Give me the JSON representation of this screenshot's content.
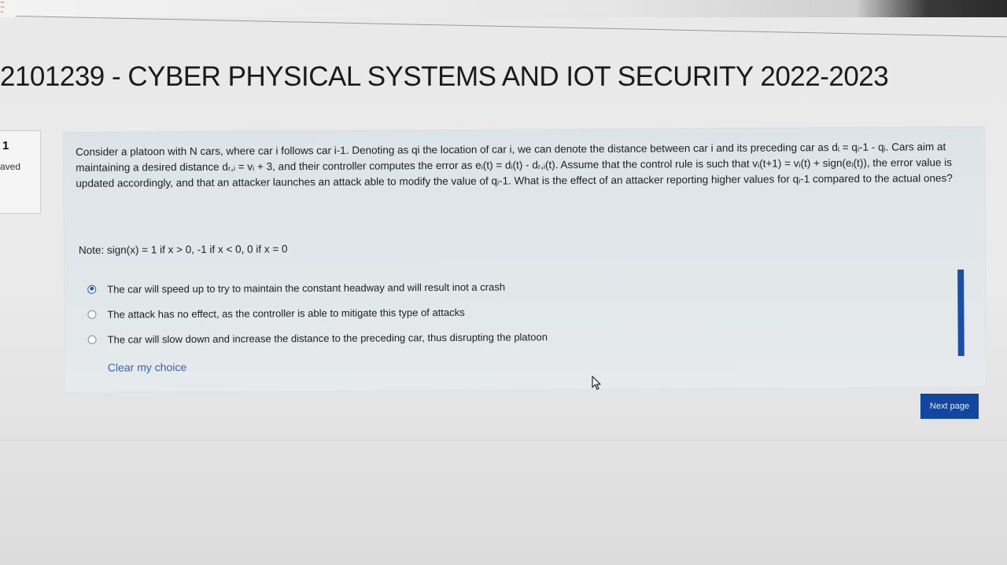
{
  "course": {
    "title": "2101239 - CYBER PHYSICAL SYSTEMS AND IOT SECURITY 2022-2023"
  },
  "question_info": {
    "number": "1",
    "state": "saved"
  },
  "question": {
    "text": "Consider a platoon with N cars, where car i follows car i-1. Denoting as qi the location of car i, we can denote the distance between car i and its preceding car as dᵢ = qᵢ-1 - qᵢ. Cars aim at maintaining a desired distance dᵣ,ᵢ = vᵢ + 3, and their controller computes the error as eᵢ(t) = dᵢ(t) - dᵣ,ᵢ(t). Assume that the control rule is such that vᵢ(t+1) = vᵢ(t) + sign(eᵢ(t)), the error value is updated accordingly, and that an attacker launches an attack able to modify the value of qᵢ-1. What is the effect of an attacker reporting higher values for qᵢ-1 compared to the actual ones?",
    "note": "Note: sign(x) = 1 if x > 0, -1 if x < 0, 0 if x = 0",
    "answers": [
      {
        "label": "The car will speed up to try to maintain the constant headway and will result inot a crash",
        "selected": true
      },
      {
        "label": "The attack has no effect, as the controller is able to mitigate this type of attacks",
        "selected": false
      },
      {
        "label": "The car will slow down and increase the distance to the preceding car, thus disrupting the platoon",
        "selected": false
      }
    ],
    "clear_label": "Clear my choice"
  },
  "navigation": {
    "next_label": "Next page"
  },
  "colors": {
    "accent": "#1247a0",
    "link": "#2f66b8",
    "question_bg": "#e0e6e9"
  },
  "icons": {
    "radio_selected": "radio-selected-icon",
    "radio_unselected": "radio-unselected-icon",
    "cursor": "mouse-pointer-icon"
  }
}
